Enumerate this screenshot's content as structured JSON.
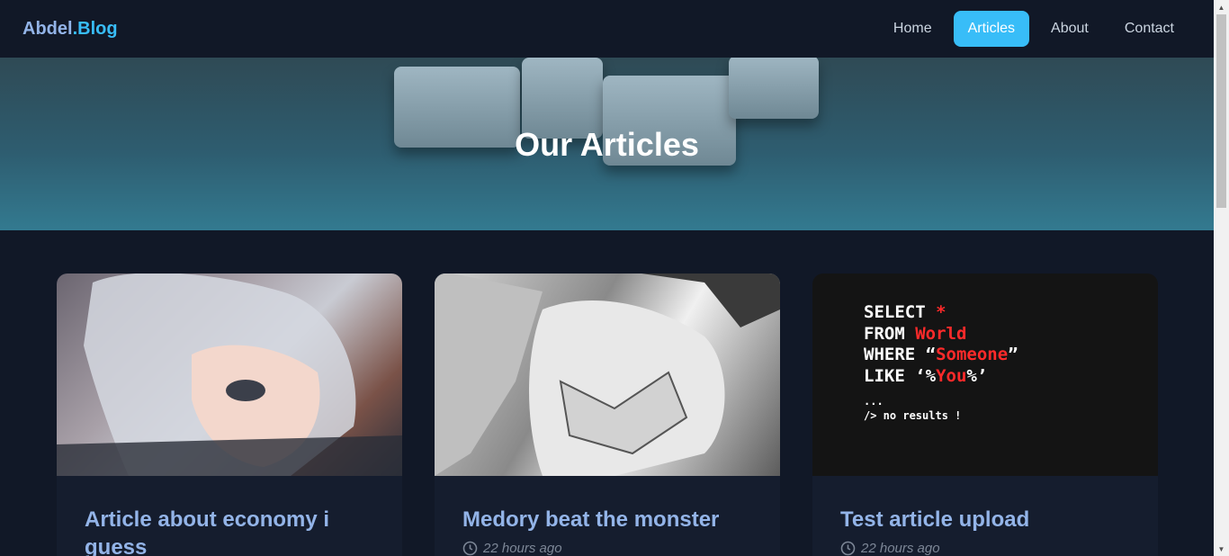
{
  "brand": {
    "name": "Abdel",
    "dot_accent": ".Blog"
  },
  "nav": {
    "items": [
      {
        "label": "Home"
      },
      {
        "label": "Articles"
      },
      {
        "label": "About"
      },
      {
        "label": "Contact"
      }
    ],
    "active": "Articles"
  },
  "hero": {
    "title": "Our Articles"
  },
  "articles": [
    {
      "title": "Article about economy i guess",
      "time": ""
    },
    {
      "title": "Medory beat the monster",
      "time": "22 hours ago"
    },
    {
      "title": "Test article upload",
      "time": "22 hours ago"
    }
  ],
  "code_image": {
    "line1": "SELECT",
    "line1_red": "*",
    "line2": "FROM",
    "line2_red": "World",
    "line3": "WHERE “",
    "line3_red": "Someone",
    "line3_end": "”",
    "line4": "LIKE ‘%",
    "line4_red": "You",
    "line4_end": "%’",
    "line5": "...",
    "line6": "/> no results !"
  },
  "colors": {
    "accent": "#38bdf8",
    "background": "#111827",
    "title": "#93b4e8"
  }
}
